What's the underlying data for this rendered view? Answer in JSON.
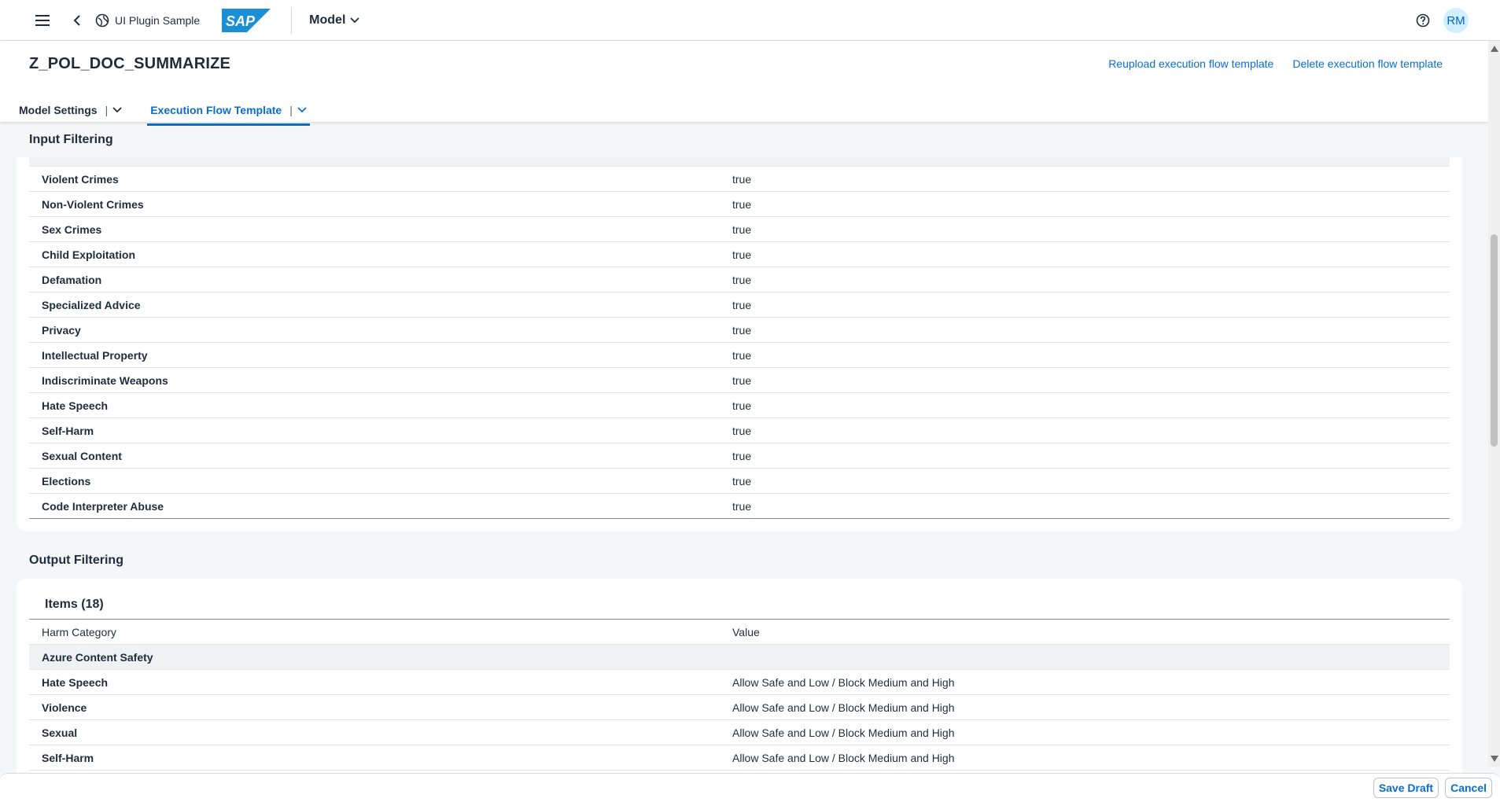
{
  "shell": {
    "app_name": "UI Plugin Sample",
    "model_menu": "Model",
    "avatar_initials": "RM",
    "logo_text": "SAP"
  },
  "header": {
    "title": "Z_POL_DOC_SUMMARIZE",
    "actions": [
      "Reupload execution flow template",
      "Delete execution flow template"
    ],
    "tabs": [
      {
        "label": "Model Settings",
        "active": false
      },
      {
        "label": "Execution Flow Template",
        "active": true
      }
    ]
  },
  "input_filtering": {
    "title": "Input Filtering",
    "rows": [
      {
        "category": "Violent Crimes",
        "value": "true"
      },
      {
        "category": "Non-Violent Crimes",
        "value": "true"
      },
      {
        "category": "Sex Crimes",
        "value": "true"
      },
      {
        "category": "Child Exploitation",
        "value": "true"
      },
      {
        "category": "Defamation",
        "value": "true"
      },
      {
        "category": "Specialized Advice",
        "value": "true"
      },
      {
        "category": "Privacy",
        "value": "true"
      },
      {
        "category": "Intellectual Property",
        "value": "true"
      },
      {
        "category": "Indiscriminate Weapons",
        "value": "true"
      },
      {
        "category": "Hate Speech",
        "value": "true"
      },
      {
        "category": "Self-Harm",
        "value": "true"
      },
      {
        "category": "Sexual Content",
        "value": "true"
      },
      {
        "category": "Elections",
        "value": "true"
      },
      {
        "category": "Code Interpreter Abuse",
        "value": "true"
      }
    ]
  },
  "output_filtering": {
    "title": "Output Filtering",
    "items_title": "Items (18)",
    "columns": [
      "Harm Category",
      "Value"
    ],
    "group": "Azure Content Safety",
    "rows": [
      {
        "category": "Hate Speech",
        "value": "Allow Safe and Low / Block Medium and High"
      },
      {
        "category": "Violence",
        "value": "Allow Safe and Low / Block Medium and High"
      },
      {
        "category": "Sexual",
        "value": "Allow Safe and Low / Block Medium and High"
      },
      {
        "category": "Self-Harm",
        "value": "Allow Safe and Low / Block Medium and High"
      }
    ]
  },
  "footer": {
    "save_draft": "Save Draft",
    "cancel": "Cancel"
  },
  "colors": {
    "accent": "#0a6ed1",
    "avatar_bg": "#d1efff",
    "page_bg": "#f5f6f7"
  },
  "icons": [
    "menu-icon",
    "back-icon",
    "globe-icon",
    "chevron-down-icon",
    "help-icon"
  ]
}
